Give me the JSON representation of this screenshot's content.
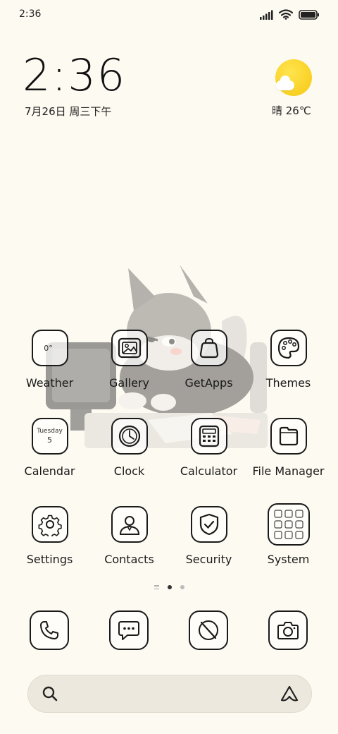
{
  "status_bar": {
    "time": "2:36"
  },
  "clock_widget": {
    "time": "2:36",
    "date": "7月26日 周三下午"
  },
  "weather_widget": {
    "summary": "晴 26℃"
  },
  "apps": [
    {
      "label": "Weather",
      "icon": "weather-icon",
      "badge": "0°"
    },
    {
      "label": "Gallery",
      "icon": "gallery-icon"
    },
    {
      "label": "GetApps",
      "icon": "shopping-bag-icon"
    },
    {
      "label": "Themes",
      "icon": "palette-icon"
    },
    {
      "label": "Calendar",
      "icon": "calendar-icon",
      "day": "Tuesday",
      "date": "5"
    },
    {
      "label": "Clock",
      "icon": "clock-icon"
    },
    {
      "label": "Calculator",
      "icon": "calculator-icon"
    },
    {
      "label": "File Manager",
      "icon": "folder-icon"
    },
    {
      "label": "Settings",
      "icon": "gear-icon"
    },
    {
      "label": "Contacts",
      "icon": "contact-icon"
    },
    {
      "label": "Security",
      "icon": "shield-check-icon"
    },
    {
      "label": "System",
      "icon": "folder-grid-icon"
    }
  ],
  "pages": {
    "count": 2,
    "current": 1
  },
  "dock": [
    {
      "icon": "phone-icon"
    },
    {
      "icon": "message-icon"
    },
    {
      "icon": "browser-icon"
    },
    {
      "icon": "camera-icon"
    }
  ],
  "colors": {
    "background": "#fdfaf1",
    "sun": "#f9d21f",
    "outline": "#1a1a1a"
  }
}
